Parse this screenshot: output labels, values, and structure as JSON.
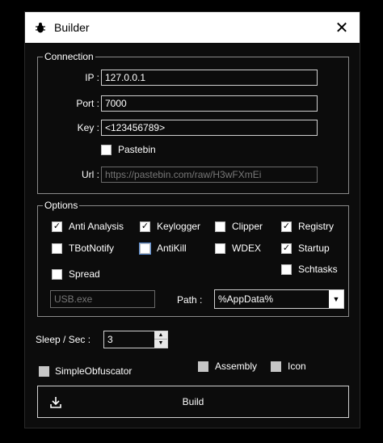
{
  "window": {
    "title": "Builder",
    "title_icon": "bug-icon",
    "close_glyph": "✕"
  },
  "connection": {
    "title": "Connection",
    "ip_label": "IP :",
    "ip_value": "127.0.0.1",
    "port_label": "Port :",
    "port_value": "7000",
    "key_label": "Key :",
    "key_value": "<123456789>",
    "pastebin_label": "Pastebin",
    "pastebin_checked": false,
    "url_label": "Url :",
    "url_value": "https://pastebin.com/raw/H3wFXmEi"
  },
  "options": {
    "title": "Options",
    "checkboxes": {
      "anti_analysis": {
        "label": "Anti Analysis",
        "checked": true
      },
      "keylogger": {
        "label": "Keylogger",
        "checked": true
      },
      "clipper": {
        "label": "Clipper",
        "checked": false
      },
      "registry": {
        "label": "Registry",
        "checked": true
      },
      "tbotnotify": {
        "label": "TBotNotify",
        "checked": false
      },
      "antikill": {
        "label": "AntiKill",
        "checked": false
      },
      "wdex": {
        "label": "WDEX",
        "checked": false
      },
      "startup": {
        "label": "Startup",
        "checked": true
      },
      "schtasks": {
        "label": "Schtasks",
        "checked": false
      },
      "spread": {
        "label": "Spread",
        "checked": false
      }
    },
    "spread_name": "USB.exe",
    "path_label": "Path :",
    "path_value": "%AppData%"
  },
  "sleep": {
    "label": "Sleep / Sec :",
    "value": "3"
  },
  "simple_obfuscator": {
    "label": "SimpleObfuscator",
    "checked": false
  },
  "assembly": {
    "label": "Assembly",
    "checked": false
  },
  "icon_opt": {
    "label": "Icon",
    "checked": false
  },
  "build": {
    "label": "Build",
    "icon": "download-icon"
  }
}
